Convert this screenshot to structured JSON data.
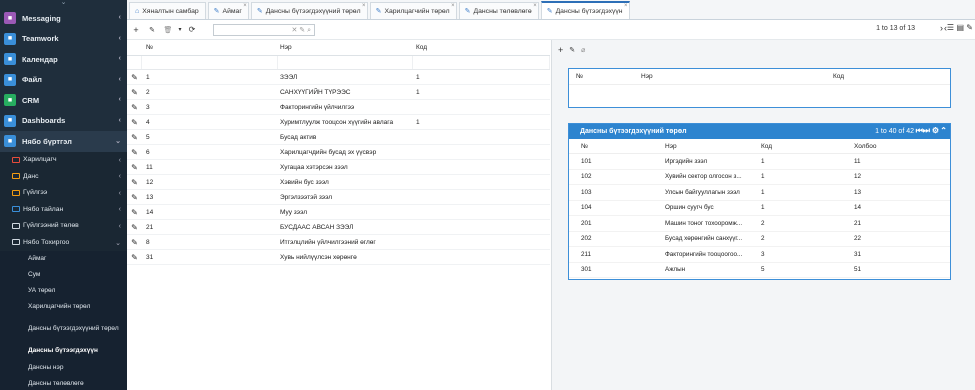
{
  "sidebar": {
    "items": [
      {
        "label": "Messaging",
        "color": "#9b59b6",
        "icon": "chat-icon"
      },
      {
        "label": "Teamwork",
        "color": "#3a8fd9",
        "icon": "person-icon"
      },
      {
        "label": "Календар",
        "color": "#3a8fd9",
        "icon": "calendar-icon"
      },
      {
        "label": "Файл",
        "color": "#3a8fd9",
        "icon": "file-icon"
      },
      {
        "label": "CRM",
        "color": "#27ae60",
        "icon": "crm-icon"
      },
      {
        "label": "Dashboards",
        "color": "#3a8fd9",
        "icon": "dashboard-icon"
      },
      {
        "label": "Нябо бүртгэл",
        "color": "#3a8fd9",
        "icon": "person-icon"
      }
    ],
    "sub": [
      {
        "label": "Харилцагч",
        "color": "#e74c3c"
      },
      {
        "label": "Данс",
        "color": "#f39c12"
      },
      {
        "label": "Гүйлгээ",
        "color": "#f39c12"
      },
      {
        "label": "Нябо тайлан",
        "color": "#3a8fd9"
      },
      {
        "label": "Гүйлгээний төлөв",
        "color": "#cfd8e0"
      },
      {
        "label": "Нябо Тохиргоо",
        "color": "#cfd8e0"
      }
    ],
    "leaves": [
      "Аймаг",
      "Сум",
      "УА төрөл",
      "Харилцагчийн төрөл",
      "Дансны бүтээгдэхүүний төрөл",
      "Дансны бүтээгдэхүүн",
      "Дансны нэр",
      "Дансны төлөвлөгө"
    ]
  },
  "tabs": [
    "Хяналтын самбар",
    "Аймаг",
    "Дансны бүтээгдэхүүний төрөл",
    "Харилцагчийн төрөл",
    "Дансны төлөвлөгө",
    "Дансны бүтээгдэхүүн"
  ],
  "pager": {
    "text": "1 to 13 of 13"
  },
  "grid": {
    "headers": [
      "№",
      "Нэр",
      "Код"
    ],
    "rows": [
      [
        "1",
        "ЗЭЭЛ",
        "1"
      ],
      [
        "2",
        "САНХҮҮГИЙН ТҮРЭЭС",
        "1"
      ],
      [
        "3",
        "Факторингийн үйлчилгээ",
        ""
      ],
      [
        "4",
        "Хуримтлуулж тооцсон хүүгийн авлага",
        "1"
      ],
      [
        "5",
        "Бусад актив",
        ""
      ],
      [
        "6",
        "Харилцагчдийн бусад эх үүсвэр",
        ""
      ],
      [
        "11",
        "Хугацаа хэтэрсэн зээл",
        ""
      ],
      [
        "12",
        "Хэвийн бус зээл",
        ""
      ],
      [
        "13",
        "Эргэлзээтэй зээл",
        ""
      ],
      [
        "14",
        "Муу зээл",
        ""
      ],
      [
        "21",
        "БУСДААС АВСАН ЗЭЭЛ",
        ""
      ],
      [
        "8",
        "Итгэлцлийн үйлчилгээний өглөг",
        ""
      ],
      [
        "31",
        "Хувь нийлүүлсэн хөрөнгө",
        ""
      ]
    ]
  },
  "card1": {
    "headers": [
      "№",
      "Нэр",
      "Код"
    ]
  },
  "card2": {
    "title": "Дансны бүтээгдэхүүний төрөл",
    "count": "1 to 40 of 42",
    "headers": [
      "№",
      "Нэр",
      "Код",
      "Холбоо"
    ],
    "rows": [
      [
        "101",
        "Иргэдийн зээл",
        "1",
        "11"
      ],
      [
        "102",
        "Хувийн сектор олгосон з...",
        "1",
        "12"
      ],
      [
        "103",
        "Улсын байгууллагын зээл",
        "1",
        "13"
      ],
      [
        "104",
        "Оршин суугч бус",
        "1",
        "14"
      ],
      [
        "201",
        "Машин тоног тохооромж...",
        "2",
        "21"
      ],
      [
        "202",
        "Бусад хөрөнгийн санхүүг...",
        "2",
        "22"
      ],
      [
        "211",
        "Факторингийн тооцоогоо...",
        "3",
        "31"
      ],
      [
        "301",
        "Ажлын",
        "5",
        "51"
      ]
    ]
  }
}
